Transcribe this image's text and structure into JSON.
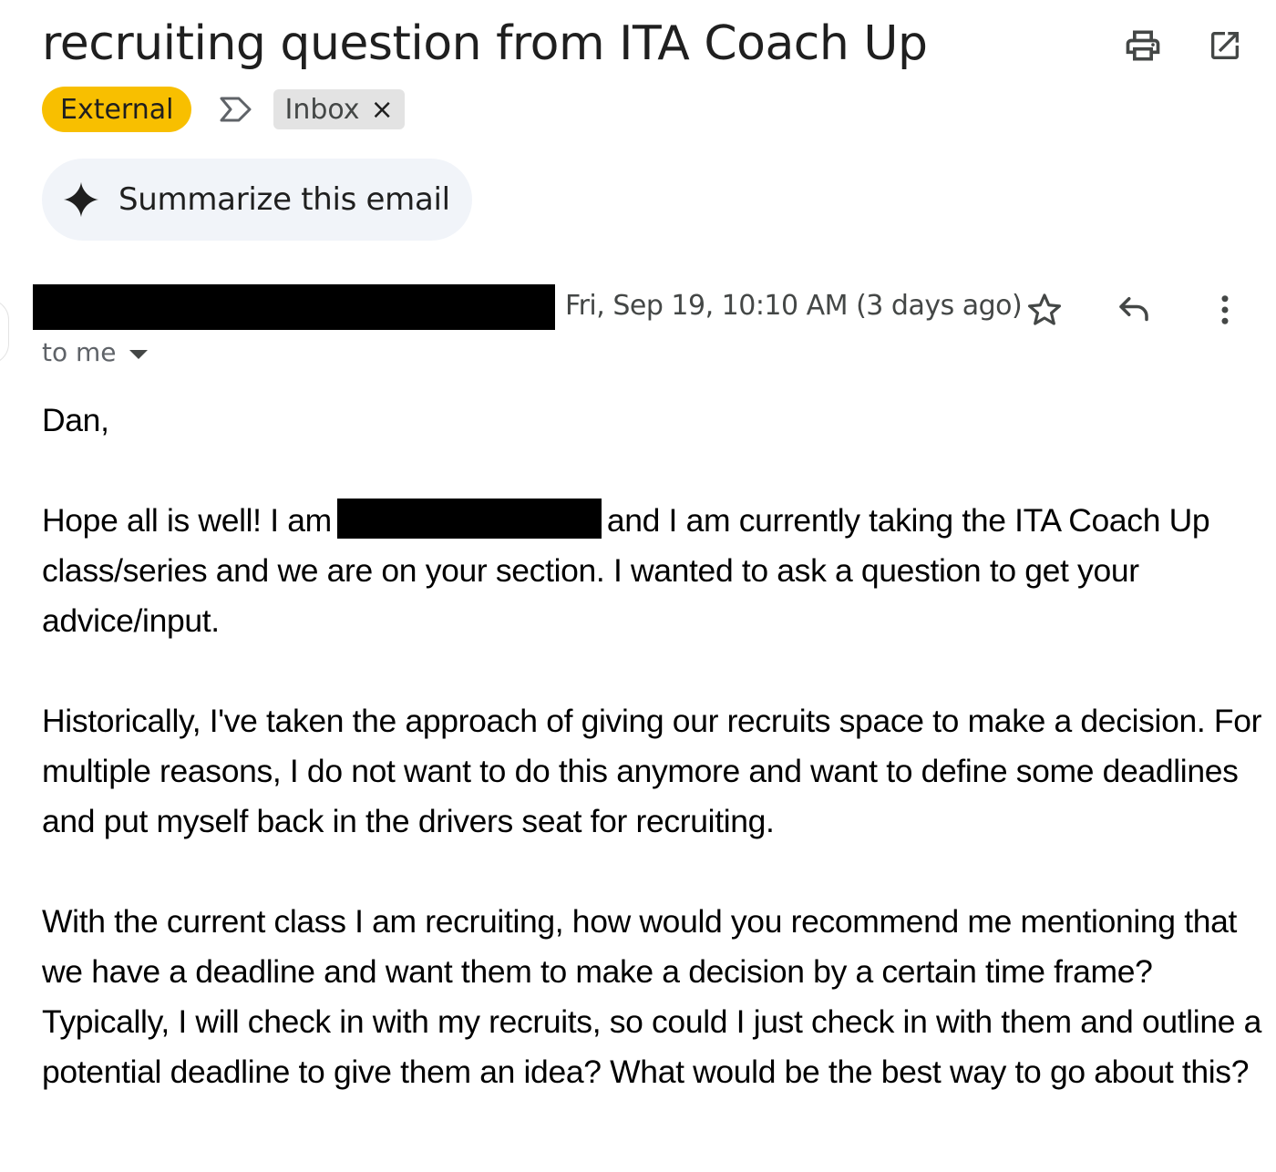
{
  "subject": "recruiting question from ITA Coach Up",
  "labels": {
    "external": "External",
    "inbox": "Inbox",
    "remove_symbol": "×"
  },
  "summarize": {
    "label": "Summarize this email"
  },
  "message": {
    "date": "Fri, Sep 19, 10:10 AM (3 days ago)",
    "recipients": "to me"
  },
  "body": {
    "greeting": "Dan,",
    "p1_before": "Hope all is well! I am",
    "p1_after": "and I am currently taking the ITA Coach Up class/series and we are on your section. I wanted to ask a question to get your advice/input.",
    "p2": "Historically, I've taken the approach of giving our recruits space to make a decision. For multiple reasons, I do not want to do this anymore and want to define some deadlines and put myself back in the drivers seat for recruiting.",
    "p3": "With the current class I am recruiting, how would you recommend me mentioning that we have a deadline and want them to make a decision by a certain time frame? Typically, I will check in with my recruits, so could I just check in with them and outline a potential deadline to give them an idea? What would be the best way to go about this?"
  },
  "icons": {
    "print": "print-icon",
    "popout": "open-in-new-window-icon",
    "importance": "importance-marker-icon",
    "sparkle": "sparkle-icon",
    "star": "star-icon",
    "reply": "reply-icon",
    "more": "more-vertical-icon",
    "caret": "caret-down-icon"
  },
  "colors": {
    "external_chip": "#f8bf00",
    "inbox_chip": "#e3e3e3",
    "summarize_bg": "#f1f4f9",
    "redaction": "#000000"
  }
}
